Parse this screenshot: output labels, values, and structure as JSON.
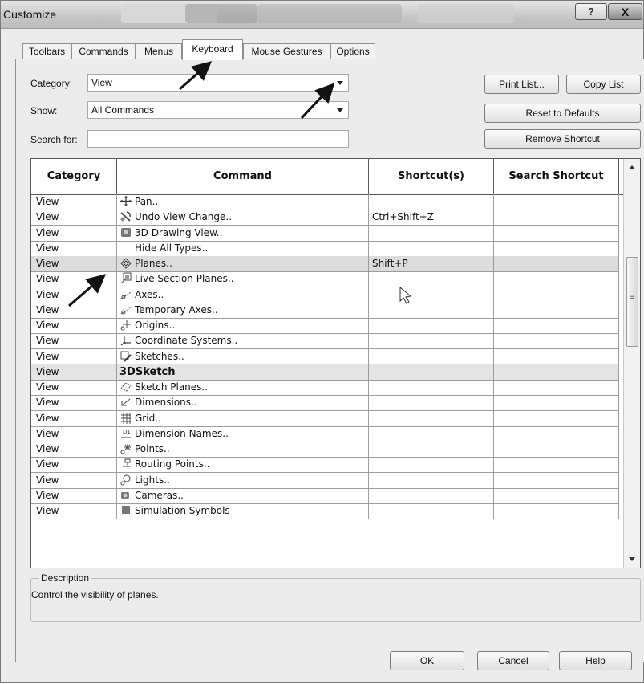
{
  "window": {
    "title": "Customize",
    "help_label": "?",
    "close_label": "X"
  },
  "tabs": [
    {
      "label": "Toolbars"
    },
    {
      "label": "Commands"
    },
    {
      "label": "Menus"
    },
    {
      "label": "Keyboard",
      "active": true
    },
    {
      "label": "Mouse Gestures"
    },
    {
      "label": "Options"
    }
  ],
  "filters": {
    "category_label": "Category:",
    "category_value": "View",
    "show_label": "Show:",
    "show_value": "All Commands",
    "search_label": "Search for:",
    "search_value": ""
  },
  "buttons": {
    "print_list": "Print List...",
    "copy_list": "Copy List",
    "reset_defaults": "Reset to Defaults",
    "remove_shortcut": "Remove Shortcut",
    "ok": "OK",
    "cancel": "Cancel",
    "help": "Help"
  },
  "table": {
    "headers": [
      "Category",
      "Command",
      "Shortcut(s)",
      "Search Shortcut"
    ],
    "rows": [
      {
        "category": "View",
        "command": "Pan..",
        "icon": "pan-icon",
        "shortcut": ""
      },
      {
        "category": "View",
        "command": "Undo View Change..",
        "icon": "undo-view-icon",
        "shortcut": "Ctrl+Shift+Z"
      },
      {
        "category": "View",
        "command": "3D Drawing View..",
        "icon": "3d-drawing-view-icon",
        "shortcut": ""
      },
      {
        "category": "View",
        "command": "Hide All Types..",
        "icon": "",
        "shortcut": ""
      },
      {
        "category": "View",
        "command": "Planes..",
        "icon": "planes-icon",
        "shortcut": "Shift+P",
        "selected": true
      },
      {
        "category": "View",
        "command": "Live Section Planes..",
        "icon": "live-section-planes-icon",
        "shortcut": ""
      },
      {
        "category": "View",
        "command": "Axes..",
        "icon": "axes-icon",
        "shortcut": ""
      },
      {
        "category": "View",
        "command": "Temporary Axes..",
        "icon": "temporary-axes-icon",
        "shortcut": ""
      },
      {
        "category": "View",
        "command": "Origins..",
        "icon": "origins-icon",
        "shortcut": ""
      },
      {
        "category": "View",
        "command": "Coordinate Systems..",
        "icon": "coordinate-systems-icon",
        "shortcut": ""
      },
      {
        "category": "View",
        "command": "Sketches..",
        "icon": "sketches-icon",
        "shortcut": ""
      },
      {
        "category": "View",
        "command": "3DSketch",
        "icon": "",
        "shortcut": "",
        "group": true
      },
      {
        "category": "View",
        "command": "Sketch Planes..",
        "icon": "sketch-planes-icon",
        "shortcut": ""
      },
      {
        "category": "View",
        "command": "Dimensions..",
        "icon": "dimensions-icon",
        "shortcut": ""
      },
      {
        "category": "View",
        "command": "Grid..",
        "icon": "grid-icon",
        "shortcut": ""
      },
      {
        "category": "View",
        "command": "Dimension Names..",
        "icon": "dimension-names-icon",
        "shortcut": ""
      },
      {
        "category": "View",
        "command": "Points..",
        "icon": "points-icon",
        "shortcut": ""
      },
      {
        "category": "View",
        "command": "Routing Points..",
        "icon": "routing-points-icon",
        "shortcut": ""
      },
      {
        "category": "View",
        "command": "Lights..",
        "icon": "lights-icon",
        "shortcut": ""
      },
      {
        "category": "View",
        "command": "Cameras..",
        "icon": "cameras-icon",
        "shortcut": ""
      },
      {
        "category": "View",
        "command": "Simulation Symbols",
        "icon": "simulation-symbols-icon",
        "shortcut": ""
      }
    ]
  },
  "description": {
    "legend": "Description",
    "text": "Control the visibility of planes."
  },
  "scrollbar": {
    "grip_label": "≡"
  }
}
